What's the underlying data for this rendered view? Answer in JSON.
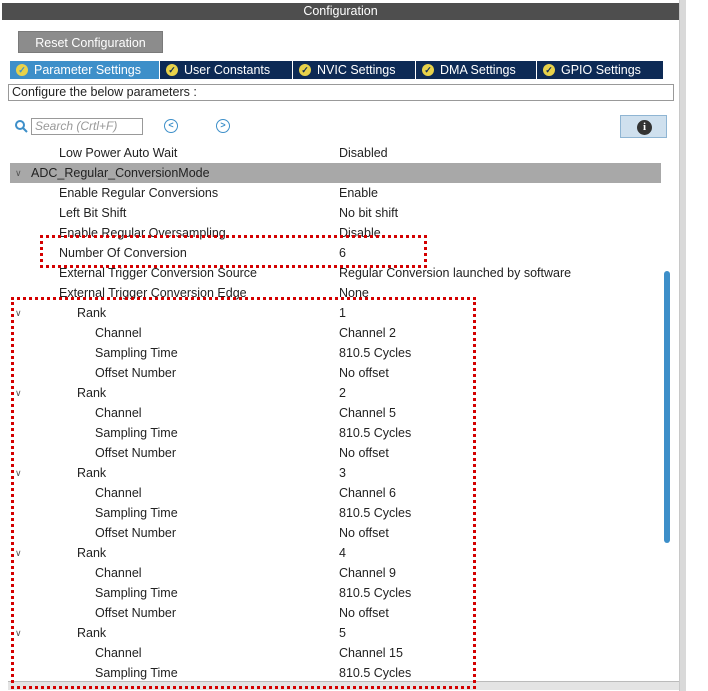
{
  "window": {
    "title": "Configuration"
  },
  "toolbar": {
    "reset_label": "Reset Configuration"
  },
  "tabs": [
    {
      "label": "Parameter Settings",
      "active": true
    },
    {
      "label": "User Constants",
      "active": false
    },
    {
      "label": "NVIC Settings",
      "active": false
    },
    {
      "label": "DMA Settings",
      "active": false
    },
    {
      "label": "GPIO Settings",
      "active": false
    }
  ],
  "configure_text": "Configure the below parameters :",
  "search": {
    "placeholder": "Search (Crtl+F)"
  },
  "icons": {
    "search": "search-icon",
    "prev": "chevron-left-icon",
    "next": "chevron-right-icon",
    "info": "info-icon",
    "check": "check-icon",
    "expand": "chevron-down-icon"
  },
  "colors": {
    "accent": "#3d8fc9",
    "tab_bg": "#0d2a55",
    "check": "#e8d24a",
    "highlight": "#d40000"
  },
  "rows": [
    {
      "name": "Low Power Auto Wait",
      "value": "Disabled"
    },
    {
      "name": "ADC_Regular_ConversionMode",
      "value": ""
    },
    {
      "name": "Enable Regular Conversions",
      "value": "Enable"
    },
    {
      "name": "Left Bit Shift",
      "value": "No bit shift"
    },
    {
      "name": "Enable Regular Oversampling",
      "value": "Disable"
    },
    {
      "name": "Number Of Conversion",
      "value": "6"
    },
    {
      "name": "External Trigger Conversion Source",
      "value": "Regular Conversion launched by software"
    },
    {
      "name": "External Trigger Conversion Edge",
      "value": "None"
    },
    {
      "name": "Rank",
      "value": "1"
    },
    {
      "name": "Channel",
      "value": "Channel 2"
    },
    {
      "name": "Sampling Time",
      "value": "810.5 Cycles"
    },
    {
      "name": "Offset Number",
      "value": "No offset"
    },
    {
      "name": "Rank",
      "value": "2"
    },
    {
      "name": "Channel",
      "value": "Channel 5"
    },
    {
      "name": "Sampling Time",
      "value": "810.5 Cycles"
    },
    {
      "name": "Offset Number",
      "value": "No offset"
    },
    {
      "name": "Rank",
      "value": "3"
    },
    {
      "name": "Channel",
      "value": "Channel 6"
    },
    {
      "name": "Sampling Time",
      "value": "810.5 Cycles"
    },
    {
      "name": "Offset Number",
      "value": "No offset"
    },
    {
      "name": "Rank",
      "value": "4"
    },
    {
      "name": "Channel",
      "value": "Channel 9"
    },
    {
      "name": "Sampling Time",
      "value": "810.5 Cycles"
    },
    {
      "name": "Offset Number",
      "value": "No offset"
    },
    {
      "name": "Rank",
      "value": "5"
    },
    {
      "name": "Channel",
      "value": "Channel 15"
    },
    {
      "name": "Sampling Time",
      "value": "810.5 Cycles"
    }
  ]
}
